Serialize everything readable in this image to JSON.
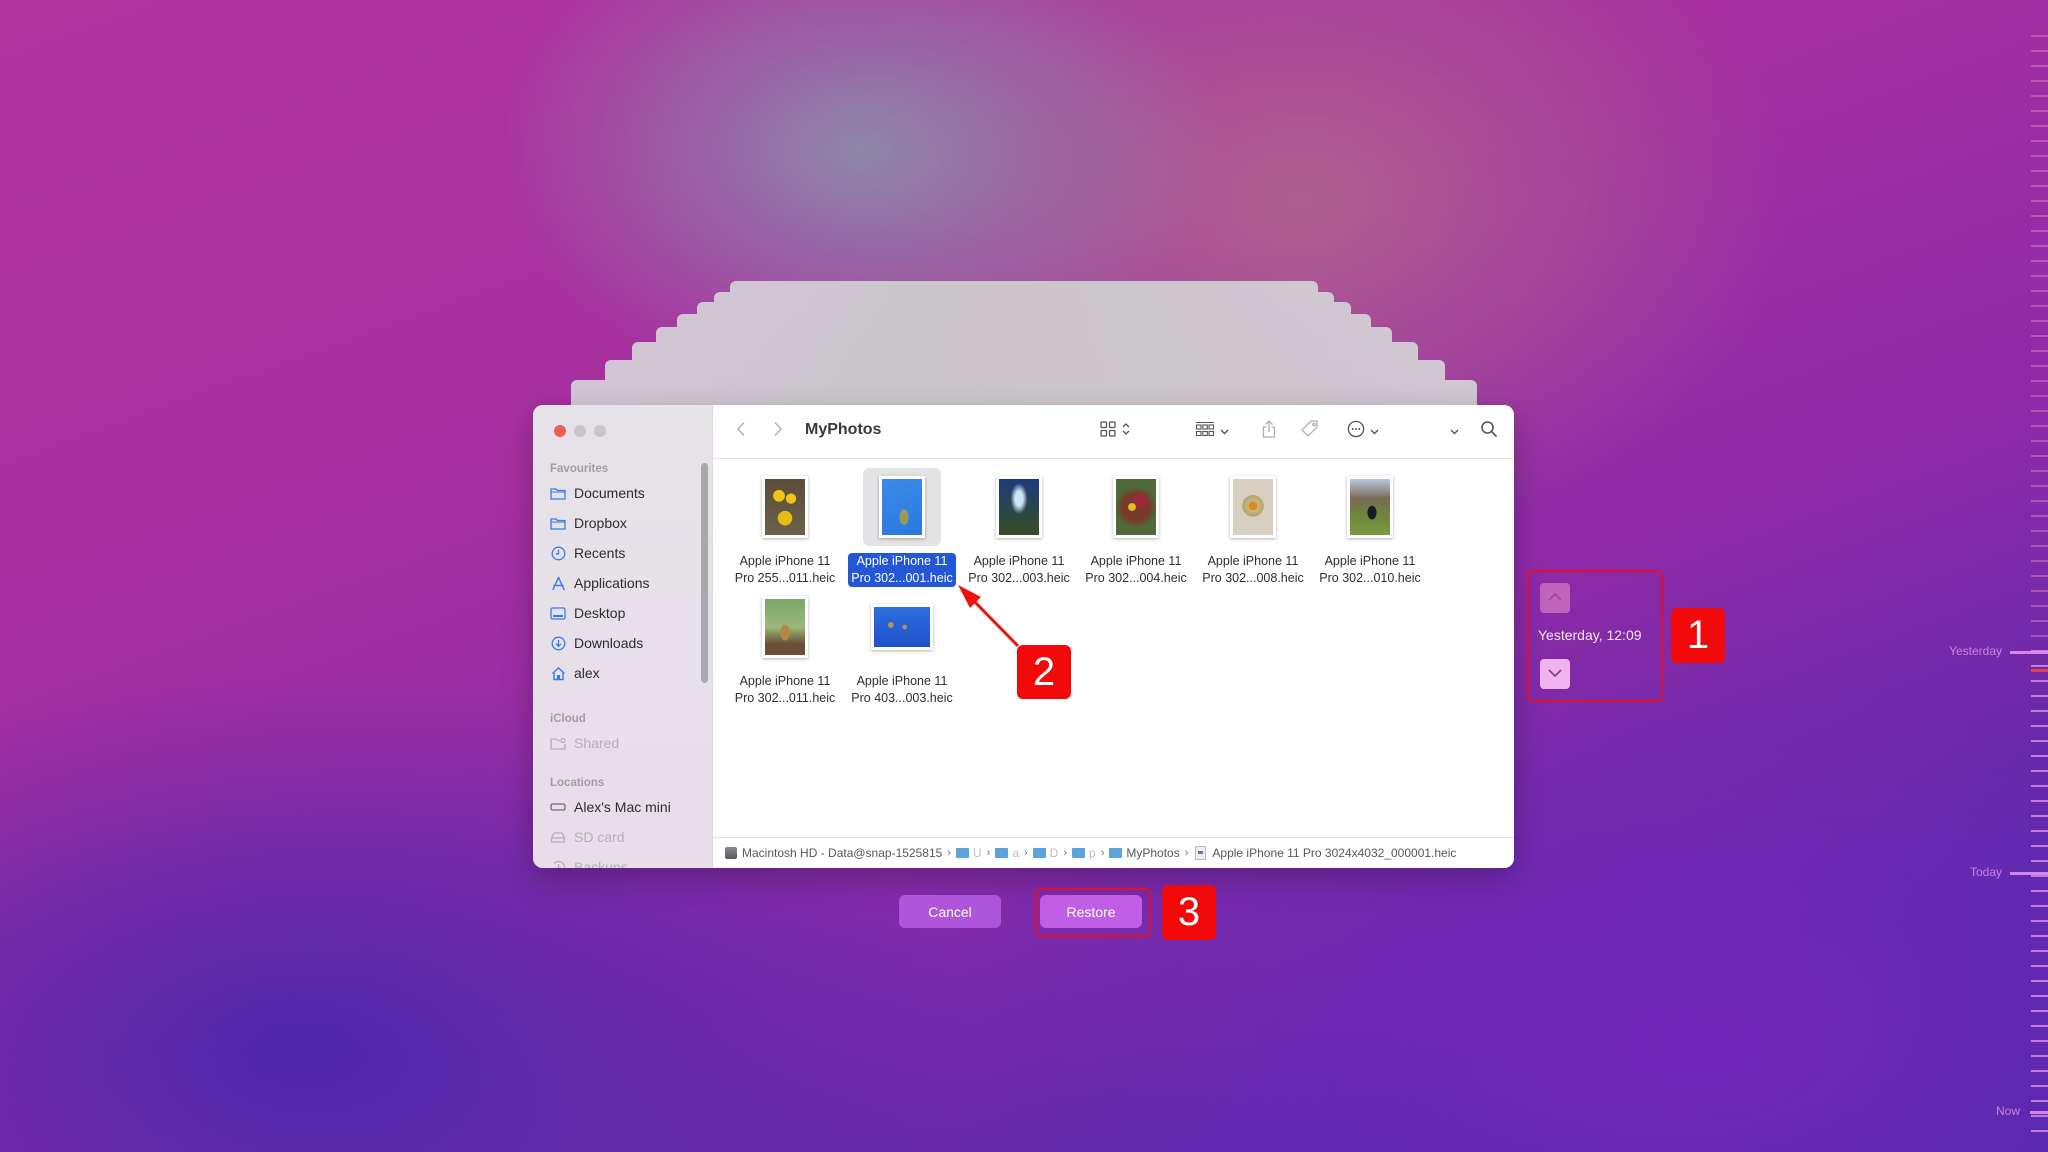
{
  "window": {
    "title": "MyPhotos",
    "traffic_lights": {
      "close": "#ee5d52",
      "minimize": "#c8c6ca",
      "zoom": "#c8c6ca"
    }
  },
  "toolbar": {
    "back_icon": "chevron-left-icon",
    "forward_icon": "chevron-right-icon",
    "view_icon": "icon-view-grid-icon",
    "group_icon": "group-by-icon",
    "share_icon": "share-icon",
    "tag_icon": "tag-icon",
    "more_icon": "ellipsis-circle-icon",
    "expand_icon": "chevron-down-icon",
    "search_icon": "search-icon"
  },
  "sidebar": {
    "sections": [
      {
        "header": "Favourites",
        "items": [
          {
            "label": "Documents",
            "icon": "folder-icon",
            "enabled": true
          },
          {
            "label": "Dropbox",
            "icon": "folder-icon",
            "enabled": true
          },
          {
            "label": "Recents",
            "icon": "clock-icon",
            "enabled": true
          },
          {
            "label": "Applications",
            "icon": "applications-icon",
            "enabled": true
          },
          {
            "label": "Desktop",
            "icon": "desktop-icon",
            "enabled": true
          },
          {
            "label": "Downloads",
            "icon": "download-icon",
            "enabled": true
          },
          {
            "label": "alex",
            "icon": "home-icon",
            "enabled": true
          }
        ]
      },
      {
        "header": "iCloud",
        "items": [
          {
            "label": "Shared",
            "icon": "shared-folder-icon",
            "enabled": false
          }
        ]
      },
      {
        "header": "Locations",
        "items": [
          {
            "label": "Alex's Mac mini",
            "icon": "computer-icon",
            "enabled": true
          },
          {
            "label": "SD card",
            "icon": "drive-icon",
            "enabled": false
          },
          {
            "label": "Backups",
            "icon": "time-machine-icon",
            "enabled": false
          }
        ]
      }
    ]
  },
  "files": [
    {
      "line1": "Apple iPhone 11",
      "line2": "Pro 255...011.heic",
      "selected": false,
      "thumb": "yellow-flowers"
    },
    {
      "line1": "Apple iPhone 11",
      "line2": "Pro 302...001.heic",
      "selected": true,
      "thumb": "jellyfish"
    },
    {
      "line1": "Apple iPhone 11",
      "line2": "Pro 302...003.heic",
      "selected": false,
      "thumb": "forest-sky"
    },
    {
      "line1": "Apple iPhone 11",
      "line2": "Pro 302...004.heic",
      "selected": false,
      "thumb": "salad"
    },
    {
      "line1": "Apple iPhone 11",
      "line2": "Pro 302...008.heic",
      "selected": false,
      "thumb": "orange-plate"
    },
    {
      "line1": "Apple iPhone 11",
      "line2": "Pro 302...010.heic",
      "selected": false,
      "thumb": "cat-in-park"
    },
    {
      "line1": "Apple iPhone 11",
      "line2": "Pro 302...011.heic",
      "selected": false,
      "thumb": "rooster"
    },
    {
      "line1": "Apple iPhone 11",
      "line2": "Pro 403...003.heic",
      "selected": false,
      "thumb": "jellyfish-group"
    }
  ],
  "pathbar": {
    "segments": [
      {
        "label": "Macintosh HD - Data@snap-1525815",
        "icon": "disk-icon",
        "dim": false
      },
      {
        "label": "U",
        "icon": "folder-icon",
        "dim": true
      },
      {
        "label": "a",
        "icon": "folder-icon",
        "dim": true
      },
      {
        "label": "D",
        "icon": "folder-icon",
        "dim": true
      },
      {
        "label": "p",
        "icon": "folder-icon",
        "dim": true
      },
      {
        "label": "MyPhotos",
        "icon": "folder-icon",
        "dim": false
      },
      {
        "label": "Apple iPhone 11 Pro 3024x4032_000001.heic",
        "icon": "image-file-icon",
        "dim": false
      }
    ]
  },
  "actions": {
    "cancel_label": "Cancel",
    "restore_label": "Restore"
  },
  "snapshot_nav": {
    "date_label": "Yesterday, 12:09",
    "up_icon": "chevron-up-icon",
    "down_icon": "chevron-down-icon"
  },
  "annotations": {
    "badge1": "1",
    "badge2": "2",
    "badge3": "3",
    "color": "#f20a0a"
  },
  "timeline": {
    "labels": [
      "Yesterday",
      "Today",
      "Now"
    ],
    "current_marker_color": "#e0424a"
  }
}
